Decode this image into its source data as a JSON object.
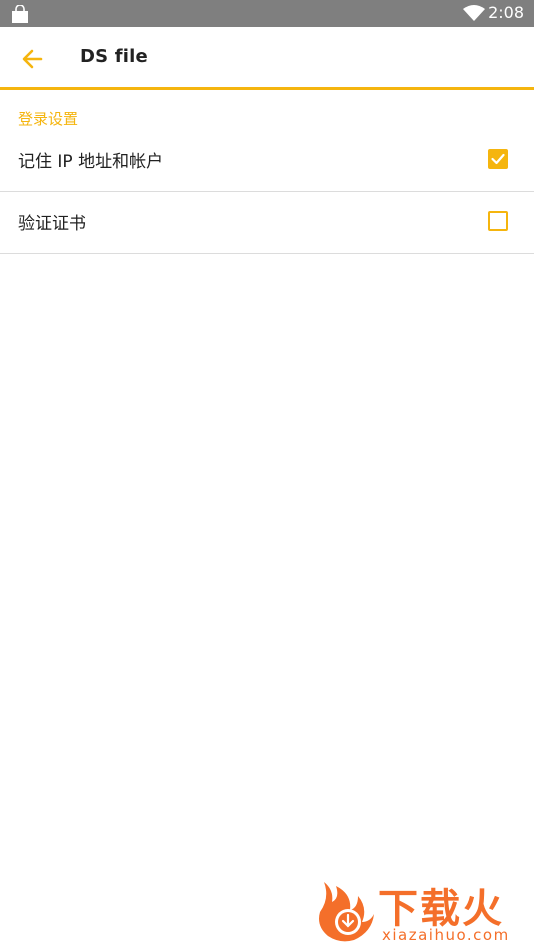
{
  "status_bar": {
    "time": "2:08",
    "icons": [
      "shopping-bag-icon",
      "wifi-icon"
    ]
  },
  "app_bar": {
    "title": "DS file",
    "back_icon": "arrow-left-icon"
  },
  "section": {
    "header": "登录设置",
    "items": [
      {
        "label": "记住 IP 地址和帐户",
        "checked": true
      },
      {
        "label": "验证证书",
        "checked": false
      }
    ]
  },
  "watermark": {
    "brand_cn": "下载火",
    "brand_en": "xiazaihuo.com"
  },
  "colors": {
    "accent": "#f5b50e",
    "status_bar": "#7f7f7f",
    "watermark": "#f46f2a"
  }
}
